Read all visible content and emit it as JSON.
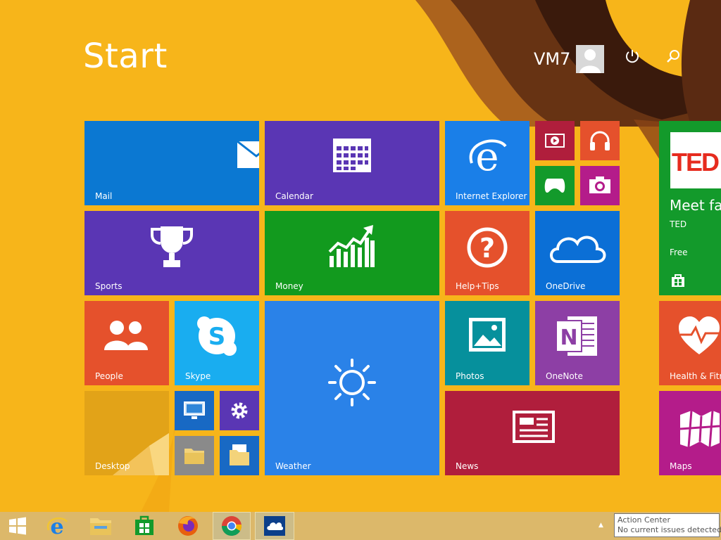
{
  "screen": {
    "title": "Start",
    "background_color": "#f7b51a"
  },
  "user": {
    "name": "VM7"
  },
  "header": {
    "power_icon": "power-icon",
    "search_icon": "search-icon"
  },
  "tiles": {
    "mail": {
      "label": "Mail",
      "color": "#0b78d2"
    },
    "calendar": {
      "label": "Calendar",
      "color": "#5a36b4"
    },
    "ie": {
      "label": "Internet Explorer",
      "color": "#1a7fe8"
    },
    "video": {
      "label": "",
      "color": "#b01e3c"
    },
    "music": {
      "label": "",
      "color": "#e5512c"
    },
    "games": {
      "label": "",
      "color": "#139a2b"
    },
    "camera": {
      "label": "",
      "color": "#b41c8a"
    },
    "sports": {
      "label": "Sports",
      "color": "#5a36b4"
    },
    "money": {
      "label": "Money",
      "color": "#129a1e"
    },
    "help": {
      "label": "Help+Tips",
      "color": "#e5512c"
    },
    "onedrive": {
      "label": "OneDrive",
      "color": "#0b6fd6"
    },
    "people": {
      "label": "People",
      "color": "#e5512c"
    },
    "skype": {
      "label": "Skype",
      "color": "#19adf0"
    },
    "weather": {
      "label": "Weather",
      "color": "#2a82e8"
    },
    "photos": {
      "label": "Photos",
      "color": "#06909c"
    },
    "onenote": {
      "label": "OneNote",
      "color": "#8d3fa5"
    },
    "desktop": {
      "label": "Desktop",
      "color": "#e2a318"
    },
    "this_pc": {
      "label": "",
      "color": "#1869c4"
    },
    "settings": {
      "label": "",
      "color": "#5a36b4"
    },
    "file_explorer": {
      "label": "",
      "color": "#8a8a8a"
    },
    "documents": {
      "label": "",
      "color": "#1869c4"
    },
    "news": {
      "label": "News",
      "color": "#b01e3c"
    },
    "ted": {
      "headline": "Meet fas",
      "publisher": "TED",
      "price": "Free",
      "logo_text": "TED",
      "color": "#139a2b"
    },
    "health": {
      "label": "Health & Fitne",
      "color": "#e5512c"
    },
    "maps": {
      "label": "Maps",
      "color": "#b41c8a"
    }
  },
  "taskbar": {
    "items": [
      "start-button",
      "internet-explorer",
      "file-explorer",
      "store",
      "firefox",
      "chrome",
      "onedrive"
    ],
    "tray_arrow": "▲"
  },
  "tooltip": {
    "title": "Action Center",
    "status": "No current issues detected"
  }
}
